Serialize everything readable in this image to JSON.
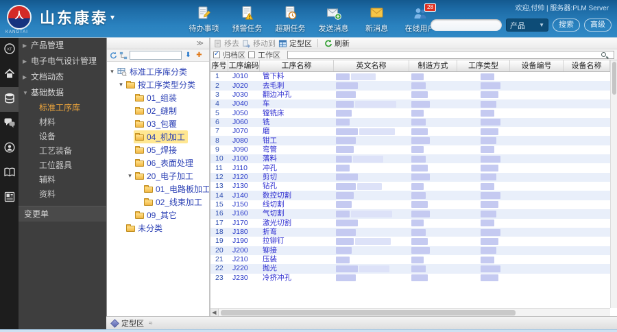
{
  "header": {
    "company": "山东康泰",
    "company_sub": "KANGTAI",
    "welcome_text": "欢迎,付帅 | 服务器:PLM Server",
    "nav_items": [
      {
        "label": "待办事项",
        "icon": "todo-icon"
      },
      {
        "label": "预警任务",
        "icon": "alert-task-icon"
      },
      {
        "label": "超期任务",
        "icon": "overdue-task-icon"
      },
      {
        "label": "发送消息",
        "icon": "send-message-icon"
      },
      {
        "label": "新消息",
        "icon": "new-message-icon"
      },
      {
        "label": "在线用户",
        "icon": "online-users-icon",
        "badge": "28"
      }
    ],
    "search": {
      "input_value": "",
      "category_label": "产品",
      "search_button": "搜索",
      "advanced_button": "高级"
    }
  },
  "iconbar": [
    {
      "name": "ktplm-logo-icon",
      "active": false
    },
    {
      "name": "home-icon",
      "active": false
    },
    {
      "name": "database-icon",
      "active": true
    },
    {
      "name": "chat-icon",
      "active": false
    },
    {
      "name": "support-icon",
      "active": false
    },
    {
      "name": "book-icon",
      "active": false
    },
    {
      "name": "news-icon",
      "active": false
    }
  ],
  "sidebar": {
    "items": [
      {
        "label": "产品管理",
        "type": "group",
        "expanded": false
      },
      {
        "label": "电子电气设计管理",
        "type": "group",
        "expanded": false
      },
      {
        "label": "文档动态",
        "type": "group",
        "expanded": false
      },
      {
        "label": "基础数据",
        "type": "group",
        "expanded": true
      },
      {
        "label": "标准工序库",
        "type": "child",
        "selected": true
      },
      {
        "label": "材料",
        "type": "child",
        "selected": false
      },
      {
        "label": "设备",
        "type": "child",
        "selected": false
      },
      {
        "label": "工艺装备",
        "type": "child",
        "selected": false
      },
      {
        "label": "工位器具",
        "type": "child",
        "selected": false
      },
      {
        "label": "辅料",
        "type": "child",
        "selected": false
      },
      {
        "label": "资料",
        "type": "child",
        "selected": false
      },
      {
        "label": "变更单",
        "type": "single",
        "selected": false
      }
    ]
  },
  "tree": {
    "nodes": [
      {
        "label": "标准工序库分类",
        "level": 0,
        "arrow": true,
        "icon": "root",
        "selected": false
      },
      {
        "label": "按工序类型分类",
        "level": 1,
        "arrow": true,
        "icon": "folder",
        "selected": false
      },
      {
        "label": "01_组装",
        "level": 2,
        "arrow": false,
        "icon": "folder",
        "selected": false
      },
      {
        "label": "02_缝制",
        "level": 2,
        "arrow": false,
        "icon": "folder",
        "selected": false
      },
      {
        "label": "03_包覆",
        "level": 2,
        "arrow": false,
        "icon": "folder",
        "selected": false
      },
      {
        "label": "04_机加工",
        "level": 2,
        "arrow": false,
        "icon": "folder",
        "selected": true
      },
      {
        "label": "05_焊接",
        "level": 2,
        "arrow": false,
        "icon": "folder",
        "selected": false
      },
      {
        "label": "06_表面处理",
        "level": 2,
        "arrow": false,
        "icon": "folder",
        "selected": false
      },
      {
        "label": "20_电子加工",
        "level": 2,
        "arrow": true,
        "icon": "folder",
        "selected": false
      },
      {
        "label": "01_电路板加工",
        "level": 3,
        "arrow": false,
        "icon": "folder",
        "selected": false
      },
      {
        "label": "02_线束加工",
        "level": 3,
        "arrow": false,
        "icon": "folder",
        "selected": false
      },
      {
        "label": "09_其它",
        "level": 2,
        "arrow": false,
        "icon": "folder",
        "selected": false
      },
      {
        "label": "未分类",
        "level": 1,
        "arrow": false,
        "icon": "folder",
        "selected": false
      }
    ]
  },
  "content": {
    "toolbar": {
      "remove": "移去",
      "move_to": "移动到",
      "finalize_area": "定型区",
      "refresh": "刷新"
    },
    "filters": {
      "archive_area": "归档区",
      "archive_checked": true,
      "work_area": "工作区",
      "work_checked": false,
      "search_value": ""
    },
    "table": {
      "columns": [
        "序号",
        "工序编码",
        "工序名称",
        "英文名称",
        "制造方式",
        "工序类型",
        "设备编号",
        "设备名称"
      ],
      "rows": [
        {
          "num": "1",
          "code": "J010",
          "name": "管下料"
        },
        {
          "num": "2",
          "code": "J020",
          "name": "去毛刺"
        },
        {
          "num": "3",
          "code": "J030",
          "name": "翻边冲孔"
        },
        {
          "num": "4",
          "code": "J040",
          "name": "车"
        },
        {
          "num": "5",
          "code": "J050",
          "name": "镗铣床"
        },
        {
          "num": "6",
          "code": "J060",
          "name": "铣"
        },
        {
          "num": "7",
          "code": "J070",
          "name": "磨"
        },
        {
          "num": "8",
          "code": "J080",
          "name": "钳工"
        },
        {
          "num": "9",
          "code": "J090",
          "name": "弯管"
        },
        {
          "num": "10",
          "code": "J100",
          "name": "落料"
        },
        {
          "num": "11",
          "code": "J110",
          "name": "冲孔"
        },
        {
          "num": "12",
          "code": "J120",
          "name": "剪切"
        },
        {
          "num": "13",
          "code": "J130",
          "name": "钻孔"
        },
        {
          "num": "14",
          "code": "J140",
          "name": "数控切割"
        },
        {
          "num": "15",
          "code": "J150",
          "name": "线切割"
        },
        {
          "num": "16",
          "code": "J160",
          "name": "气切割"
        },
        {
          "num": "17",
          "code": "J170",
          "name": "激光切割"
        },
        {
          "num": "18",
          "code": "J180",
          "name": "折弯"
        },
        {
          "num": "19",
          "code": "J190",
          "name": "拉铆钉"
        },
        {
          "num": "20",
          "code": "J200",
          "name": "铆接"
        },
        {
          "num": "21",
          "code": "J210",
          "name": "压装"
        },
        {
          "num": "22",
          "code": "J220",
          "name": "抛光"
        },
        {
          "num": "23",
          "code": "J230",
          "name": "冷挤冲孔"
        }
      ]
    }
  },
  "footer": {
    "tab_label": "定型区"
  }
}
